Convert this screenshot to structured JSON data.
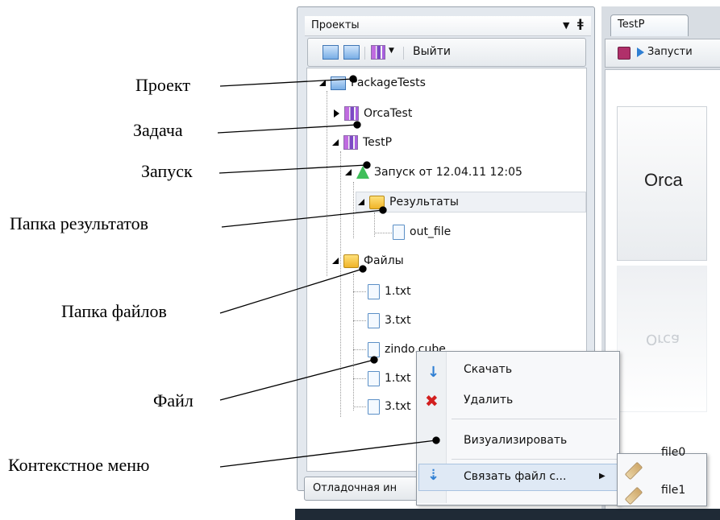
{
  "callouts": {
    "project": "Проект",
    "task": "Задача",
    "launch": "Запуск",
    "results_folder": "Папка результатов",
    "files_folder": "Папка файлов",
    "file": "Файл",
    "context_menu": "Контекстное меню"
  },
  "projects_panel": {
    "title": "Проекты",
    "pin_icon": "pin-icon",
    "dropdown_icon": "triangle-down-icon",
    "toolbar": {
      "exit_label": "Выйти"
    }
  },
  "tree": {
    "project": "PackageTests",
    "task1": "OrcaTest",
    "task2": "TestP",
    "launch": "Запуск от 12.04.11 12:05",
    "results": "Результаты",
    "out_file": "out_file",
    "files": "Файлы",
    "file_items": [
      "1.txt",
      "3.txt",
      "zindo.cube",
      "1.txt",
      "3.txt"
    ]
  },
  "bottom_tab": "Отладочная ин",
  "right_pane": {
    "tab": "TestP",
    "toolbar_run": "Запусти",
    "card_label": "Orca",
    "card_reflection": "Orca"
  },
  "context_menu": {
    "items": [
      "Скачать",
      "Удалить",
      "Визуализировать",
      "Связать файл с..."
    ]
  },
  "submenu": {
    "items": [
      "file0",
      "file1"
    ]
  },
  "colors": {
    "accent_blue": "#2f7fd3",
    "delete_red": "#d21f1f",
    "panel_bg": "#e3e8ee"
  }
}
